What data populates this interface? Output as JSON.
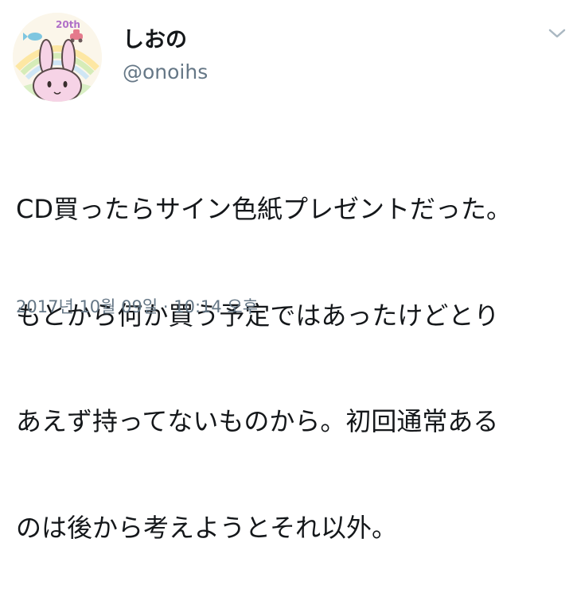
{
  "user": {
    "display_name": "しおの",
    "handle": "@onoihs",
    "avatar_icon": "rabbit-avatar-icon",
    "avatar_badge": "20th"
  },
  "tweet": {
    "text_lines": [
      "CD買ったらサイン色紙プレゼントだった。",
      "もとから何か買う予定ではあったけどとり",
      "あえず持ってないものから。初回通常ある",
      "のは後から考えようとそれ以外。"
    ],
    "timestamp": "2017년 10월 09일 · 10:14 오후"
  },
  "menu": {
    "icon": "chevron-down-icon"
  },
  "colors": {
    "text": "#14171a",
    "secondary": "#657786",
    "chevron": "#aab8c2",
    "avatar_bg": "#fbf6ea",
    "rabbit": "#f6d3e6"
  }
}
